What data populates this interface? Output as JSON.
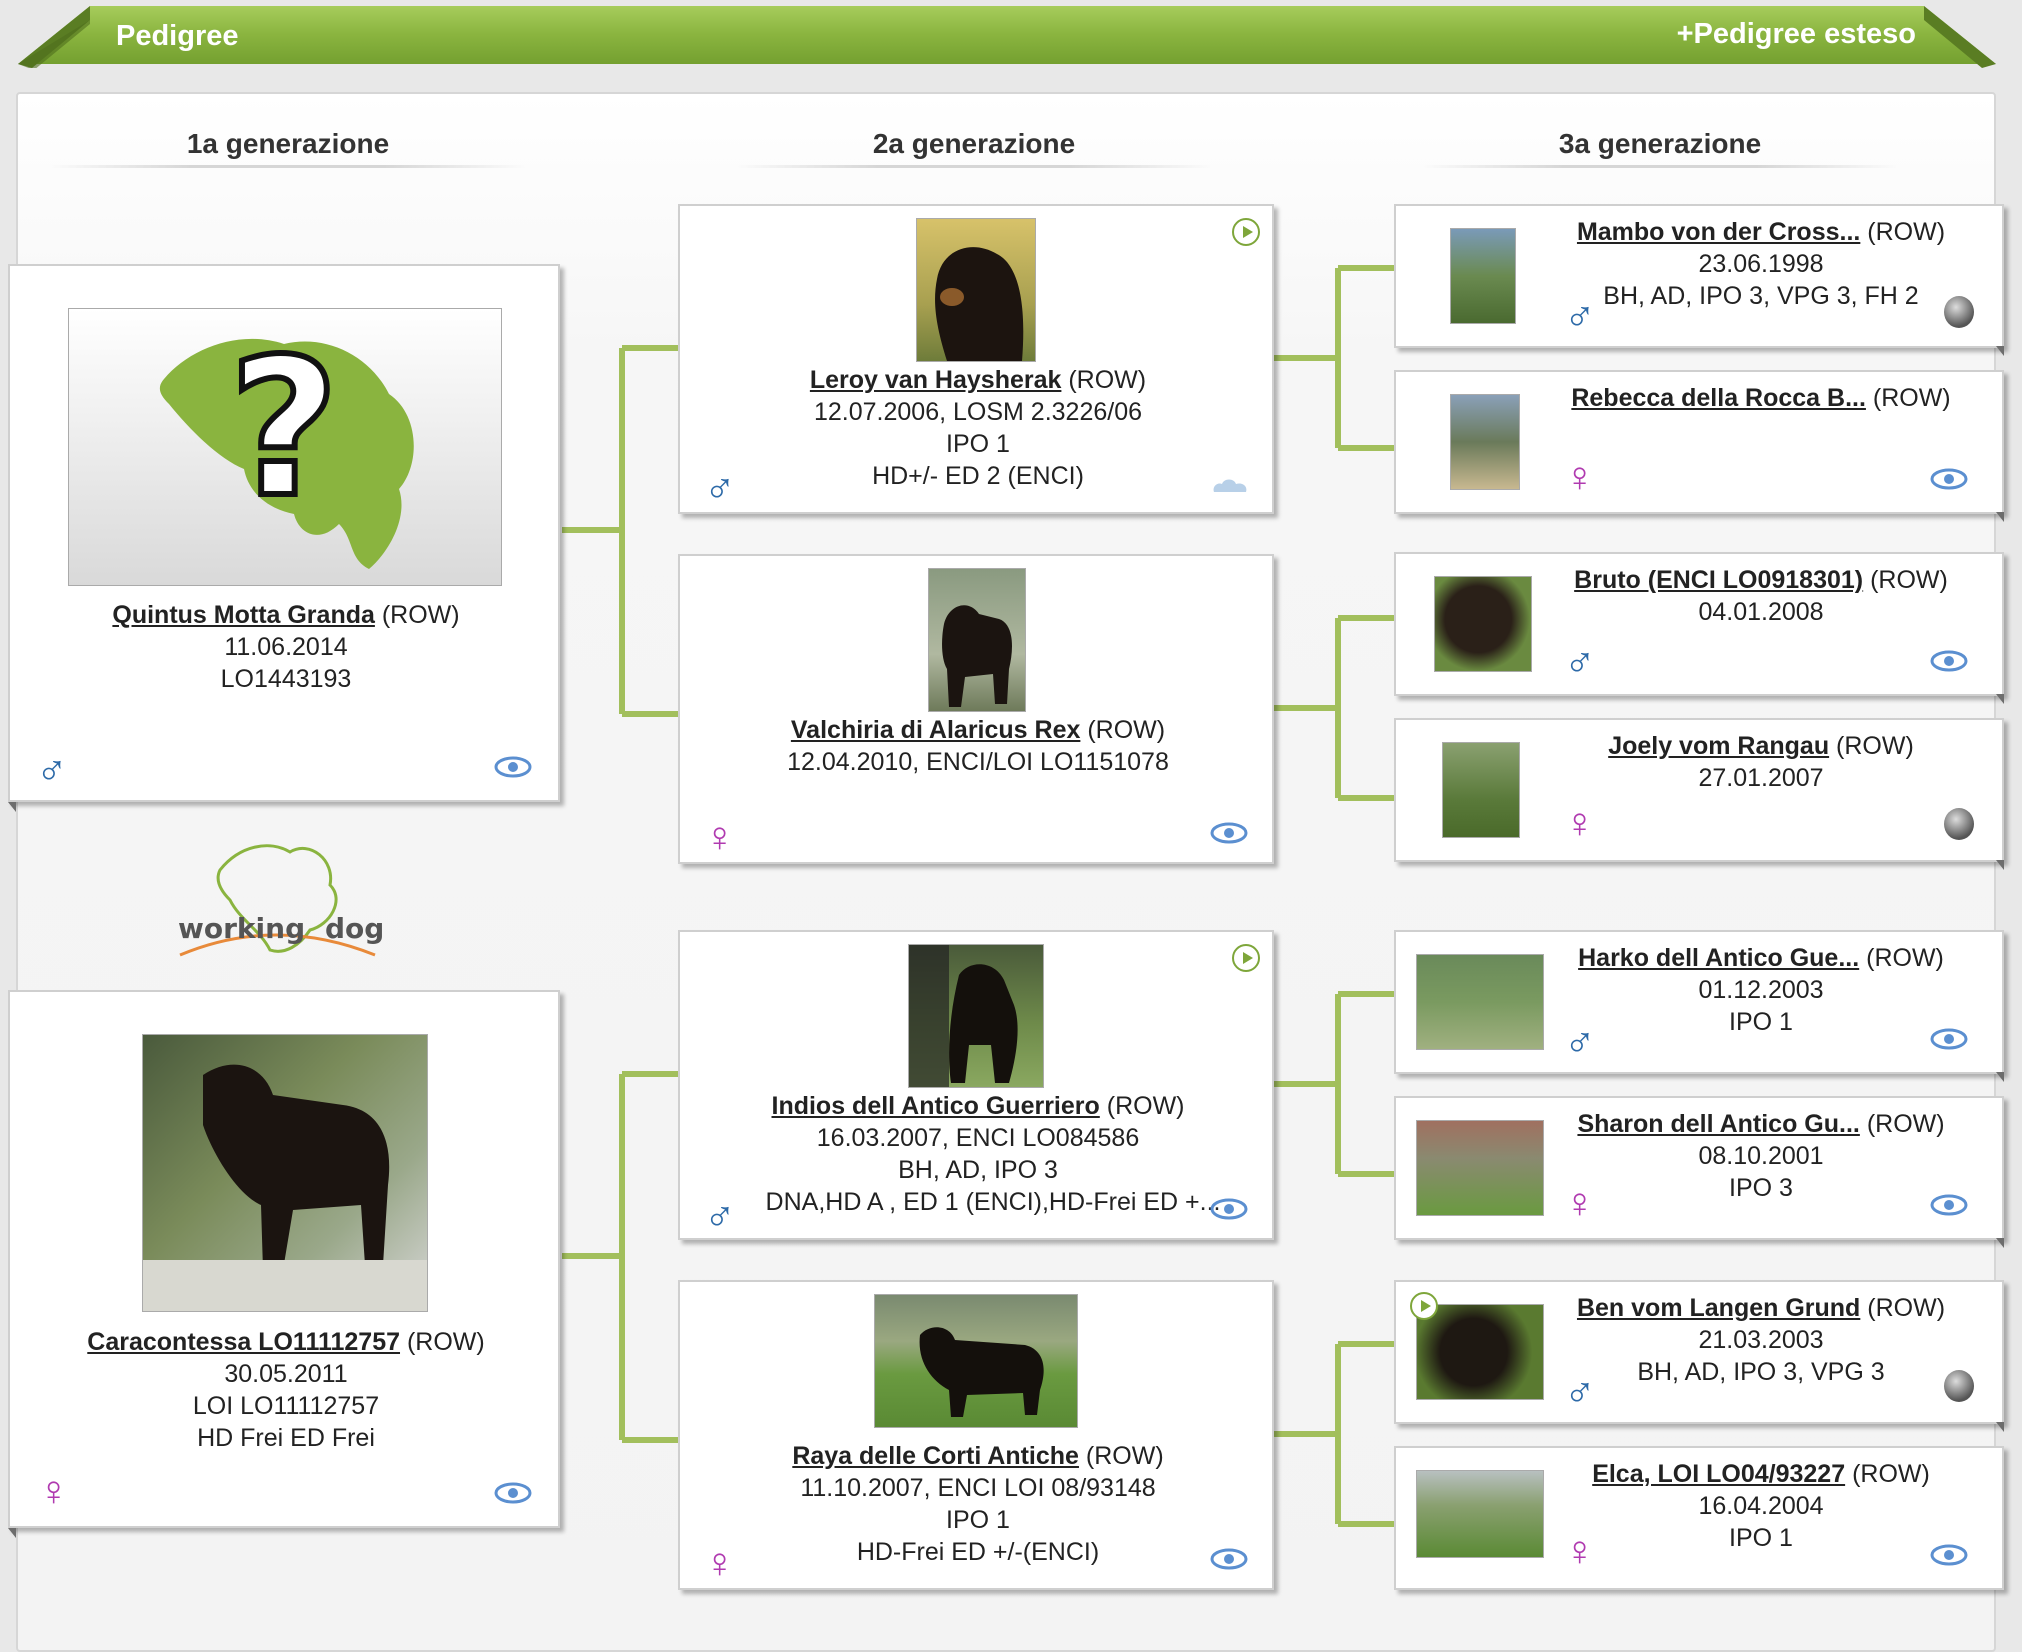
{
  "header": {
    "title": "Pedigree",
    "extended_link": "+Pedigree esteso"
  },
  "generations": [
    "1a generazione",
    "2a generazione",
    "3a generazione"
  ],
  "logo": {
    "word1": "working",
    "word2": "dog"
  },
  "gen1": [
    {
      "name": "Quintus Motta Granda",
      "breed": "(ROW)",
      "lines": [
        "11.06.2014",
        "LO1443193"
      ],
      "sex": "male"
    },
    {
      "name": "Caracontessa LO11112757",
      "breed": "(ROW)",
      "lines": [
        "30.05.2011",
        "LOI LO11112757",
        "HD Frei ED Frei"
      ],
      "sex": "female"
    }
  ],
  "gen2": [
    {
      "name": "Leroy van Haysherak",
      "breed": "(ROW)",
      "lines": [
        "12.07.2006, LOSM 2.3226/06",
        "IPO 1",
        "HD+/- ED 2 (ENCI)"
      ],
      "sex": "male"
    },
    {
      "name": "Valchiria di Alaricus Rex",
      "breed": "(ROW)",
      "lines": [
        "12.04.2010, ENCI/LOI LO1151078"
      ],
      "sex": "female"
    },
    {
      "name": "Indios dell Antico Guerriero",
      "breed": "(ROW)",
      "lines": [
        "16.03.2007, ENCI LO084586",
        "BH, AD, IPO 3",
        "DNA,HD A , ED 1 (ENCI),HD-Frei ED +..."
      ],
      "sex": "male"
    },
    {
      "name": "Raya delle Corti Antiche",
      "breed": "(ROW)",
      "lines": [
        "11.10.2007, ENCI LOI 08/93148",
        "IPO 1",
        "HD-Frei ED +/-(ENCI)"
      ],
      "sex": "female"
    }
  ],
  "gen3": [
    {
      "name": "Mambo von der Cross...",
      "breed": "(ROW)",
      "lines": [
        "23.06.1998",
        "BH, AD, IPO 3, VPG 3, FH 2"
      ],
      "sex": "male"
    },
    {
      "name": "Rebecca della Rocca B...",
      "breed": "(ROW)",
      "lines": [],
      "sex": "female"
    },
    {
      "name": "Bruto (ENCI LO0918301)",
      "breed": "(ROW)",
      "lines": [
        "04.01.2008"
      ],
      "sex": "male"
    },
    {
      "name": "Joely vom Rangau",
      "breed": "(ROW)",
      "lines": [
        "27.01.2007"
      ],
      "sex": "female"
    },
    {
      "name": "Harko dell Antico Gue...",
      "breed": "(ROW)",
      "lines": [
        "01.12.2003",
        "IPO 1"
      ],
      "sex": "male"
    },
    {
      "name": "Sharon dell Antico Gu...",
      "breed": "(ROW)",
      "lines": [
        "08.10.2001",
        "IPO 3"
      ],
      "sex": "female"
    },
    {
      "name": "Ben vom Langen Grund",
      "breed": "(ROW)",
      "lines": [
        "21.03.2003",
        "BH, AD, IPO 3, VPG 3"
      ],
      "sex": "male"
    },
    {
      "name": "Elca, LOI LO04/93227",
      "breed": "(ROW)",
      "lines": [
        "16.04.2004",
        "IPO 1"
      ],
      "sex": "female"
    }
  ],
  "symbols": {
    "male": "♂",
    "female": "♀"
  },
  "colors": {
    "ribbon": "#8ab43f",
    "connector": "#a2bf5c",
    "male": "#2d6aa8",
    "female": "#b03ab0"
  }
}
